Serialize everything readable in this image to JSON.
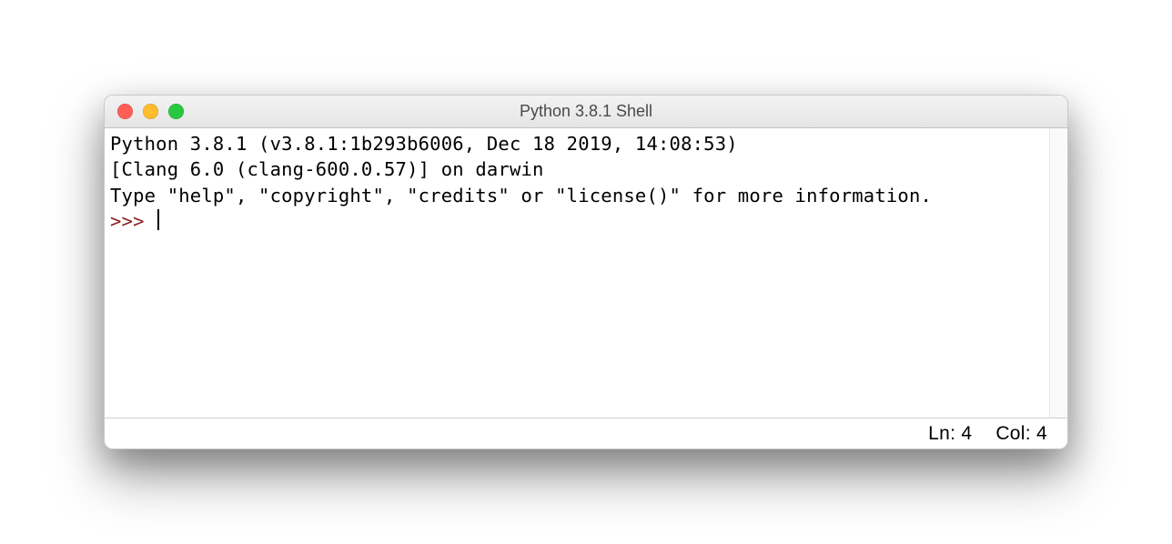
{
  "window": {
    "title": "Python 3.8.1 Shell"
  },
  "shell": {
    "line1": "Python 3.8.1 (v3.8.1:1b293b6006, Dec 18 2019, 14:08:53) ",
    "line2": "[Clang 6.0 (clang-600.0.57)] on darwin",
    "line3": "Type \"help\", \"copyright\", \"credits\" or \"license()\" for more information.",
    "prompt": ">>> "
  },
  "status": {
    "line_label": "Ln: 4",
    "col_label": "Col: 4"
  }
}
